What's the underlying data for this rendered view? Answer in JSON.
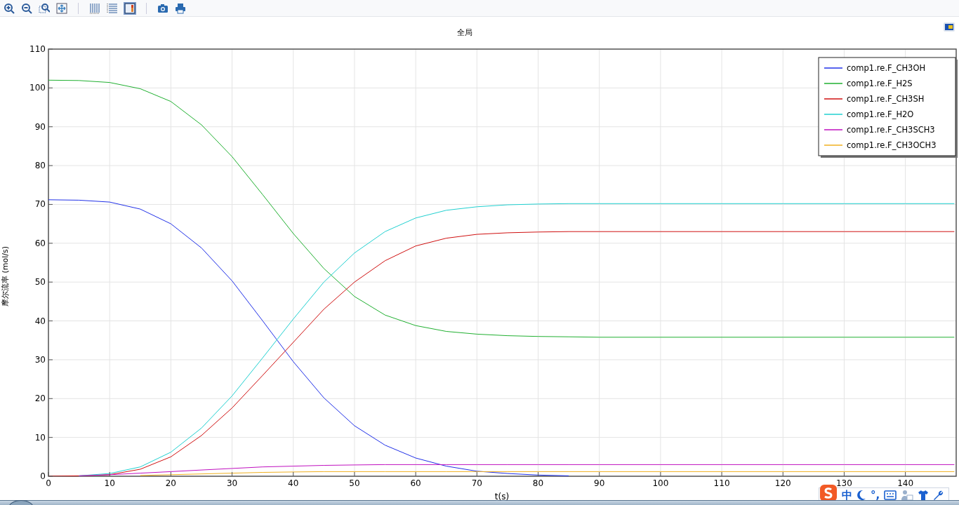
{
  "toolbar": {
    "buttons": [
      {
        "kind": "zoom-in"
      },
      {
        "kind": "zoom-out"
      },
      {
        "kind": "zoom-box"
      },
      {
        "kind": "zoom-extents"
      },
      {
        "kind": "sep"
      },
      {
        "kind": "vgrid"
      },
      {
        "kind": "hgrid"
      },
      {
        "kind": "colorbar",
        "selected": true
      },
      {
        "kind": "sep"
      },
      {
        "kind": "camera"
      },
      {
        "kind": "print"
      }
    ]
  },
  "plot": {
    "chart_data": {
      "type": "line",
      "title": "全局",
      "xlabel": "t(s)",
      "ylabel": "摩尔流率 (mol/s)",
      "x": [
        0,
        5,
        10,
        15,
        20,
        25,
        30,
        35,
        40,
        45,
        50,
        55,
        60,
        65,
        70,
        75,
        80,
        85,
        90,
        100,
        110,
        120,
        130,
        140,
        148
      ],
      "xlim": [
        0,
        148.3
      ],
      "ylim": [
        0,
        110
      ],
      "grid": true,
      "legend": true,
      "xticks": [
        0,
        10,
        20,
        30,
        40,
        50,
        60,
        70,
        80,
        90,
        100,
        110,
        120,
        130,
        140
      ],
      "yticks": [
        0,
        10,
        20,
        30,
        40,
        50,
        60,
        70,
        80,
        90,
        100,
        110
      ],
      "series": [
        {
          "name": "comp1.re.F_CH3OH",
          "color": "#2030e8",
          "values": [
            71.2,
            71.1,
            70.6,
            68.8,
            65,
            58.8,
            50.3,
            40,
            29.5,
            20.2,
            13,
            8,
            4.7,
            2.6,
            1.3,
            0.7,
            0.3,
            0.1,
            null,
            null,
            null,
            null,
            null,
            null,
            null
          ]
        },
        {
          "name": "comp1.re.F_H2S",
          "color": "#20b030",
          "values": [
            102,
            101.9,
            101.4,
            99.8,
            96.5,
            90.5,
            82.3,
            72.5,
            62.5,
            53.5,
            46.3,
            41.5,
            38.8,
            37.3,
            36.6,
            36.2,
            36,
            35.9,
            35.8,
            35.8,
            35.8,
            35.8,
            35.8,
            35.8,
            35.8
          ]
        },
        {
          "name": "comp1.re.F_CH3SH",
          "color": "#d01010",
          "values": [
            0,
            0.1,
            0.4,
            1.8,
            5,
            10.5,
            17.6,
            26,
            34.5,
            43,
            50,
            55.5,
            59.3,
            61.3,
            62.3,
            62.7,
            62.9,
            63,
            63,
            63,
            63,
            63,
            63,
            63,
            63
          ]
        },
        {
          "name": "comp1.re.F_H2O",
          "color": "#20d0d0",
          "values": [
            null,
            0.1,
            0.7,
            2.4,
            6.2,
            12.4,
            20.7,
            30.5,
            40.5,
            50,
            57.5,
            63,
            66.5,
            68.5,
            69.4,
            69.9,
            70.1,
            70.2,
            70.2,
            70.2,
            70.2,
            70.2,
            70.2,
            70.2,
            70.2
          ]
        },
        {
          "name": "comp1.re.F_CH3SCH3",
          "color": "#c010c0",
          "values": [
            null,
            0.1,
            0.4,
            0.8,
            1.2,
            1.6,
            2,
            2.4,
            2.6,
            2.8,
            2.9,
            3,
            3,
            3,
            3,
            3,
            3,
            3,
            3,
            3,
            3,
            3,
            3,
            3,
            3
          ]
        },
        {
          "name": "comp1.re.F_CH3OCH3",
          "color": "#f0b020",
          "values": [
            null,
            null,
            null,
            0.2,
            0.4,
            0.6,
            0.8,
            1,
            1.1,
            1.2,
            1.2,
            1.2,
            1.2,
            1.2,
            1.2,
            1.2,
            1.2,
            1.2,
            1.2,
            1.2,
            1.2,
            1.2,
            1.2,
            1.2,
            1.2
          ]
        }
      ]
    }
  },
  "ime_bar": {
    "language": "中",
    "punctuation": "°,"
  }
}
